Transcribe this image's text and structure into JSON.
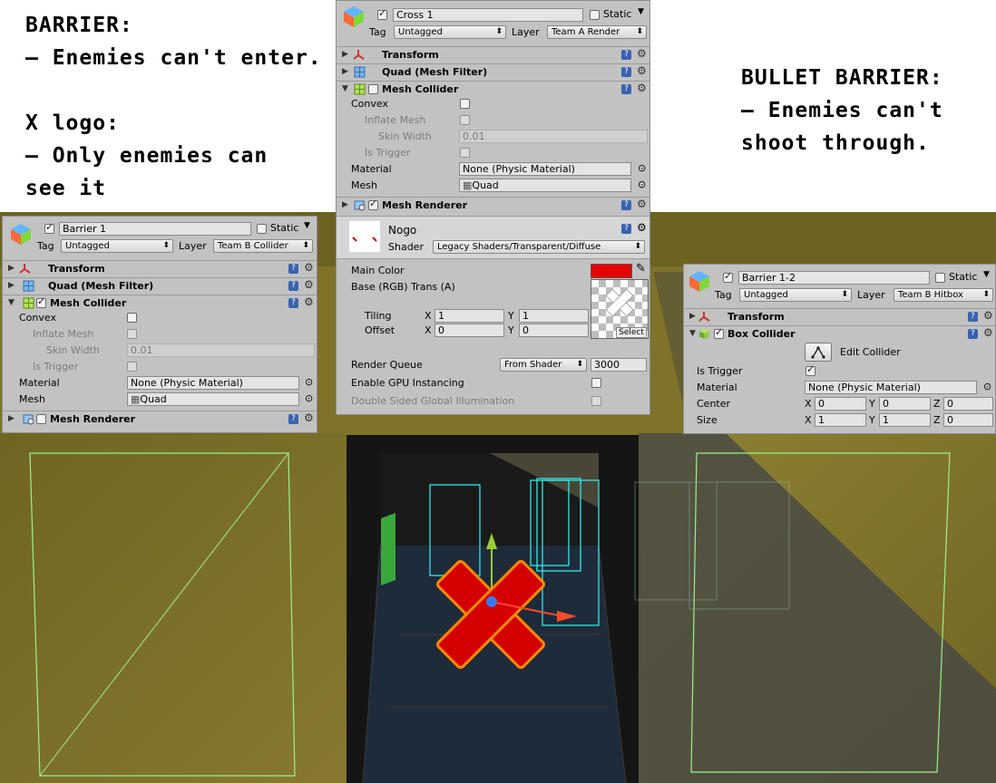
{
  "annotations": {
    "left": [
      "BARRIER:",
      "– Enemies can't enter.",
      "",
      "X logo:",
      "– Only enemies can",
      "see it"
    ],
    "right": [
      "BULLET BARRIER:",
      "– Enemies can't",
      "shoot through."
    ]
  },
  "left_inspector": {
    "object_name": "Barrier 1",
    "static_label": "Static",
    "tag_label": "Tag",
    "tag_value": "Untagged",
    "layer_label": "Layer",
    "layer_value": "Team B Collider",
    "components": {
      "transform": "Transform",
      "mesh_filter": "Quad (Mesh Filter)",
      "mesh_collider": "Mesh Collider",
      "mesh_renderer": "Mesh Renderer"
    },
    "convex_label": "Convex",
    "inflate_mesh_label": "Inflate Mesh",
    "skin_width_label": "Skin Width",
    "skin_width_value": "0.01",
    "is_trigger_label": "Is Trigger",
    "material_label": "Material",
    "material_value": "None (Physic Material)",
    "mesh_label": "Mesh",
    "mesh_value": "Quad"
  },
  "center_inspector": {
    "object_name": "Cross 1",
    "static_label": "Static",
    "tag_label": "Tag",
    "tag_value": "Untagged",
    "layer_label": "Layer",
    "layer_value": "Team A Render",
    "components": {
      "transform": "Transform",
      "mesh_filter": "Quad (Mesh Filter)",
      "mesh_collider": "Mesh Collider",
      "mesh_renderer": "Mesh Renderer"
    },
    "convex_label": "Convex",
    "inflate_mesh_label": "Inflate Mesh",
    "skin_width_label": "Skin Width",
    "skin_width_value": "0.01",
    "is_trigger_label": "Is Trigger",
    "material_label": "Material",
    "material_value": "None (Physic Material)",
    "mesh_label": "Mesh",
    "mesh_value": "Quad",
    "material_name": "Nogo",
    "shader_label": "Shader",
    "shader_value": "Legacy Shaders/Transparent/Diffuse",
    "main_color_label": "Main Color",
    "main_color": "#e60000",
    "base_label": "Base (RGB) Trans (A)",
    "tiling_label": "Tiling",
    "offset_label": "Offset",
    "tiling_x": "1",
    "tiling_y": "1",
    "offset_x": "0",
    "offset_y": "0",
    "select_label": "Select",
    "render_queue_label": "Render Queue",
    "render_queue_mode": "From Shader",
    "render_queue_value": "3000",
    "gpu_instancing_label": "Enable GPU Instancing",
    "double_sided_label": "Double Sided Global Illumination",
    "x": "X",
    "y": "Y"
  },
  "right_inspector": {
    "object_name": "Barrier 1-2",
    "static_label": "Static",
    "tag_label": "Tag",
    "tag_value": "Untagged",
    "layer_label": "Layer",
    "layer_value": "Team B Hitbox",
    "components": {
      "transform": "Transform",
      "box_collider": "Box Collider"
    },
    "edit_collider_label": "Edit Collider",
    "is_trigger_label": "Is Trigger",
    "material_label": "Material",
    "material_value": "None (Physic Material)",
    "center_label": "Center",
    "size_label": "Size",
    "center_x": "0",
    "center_y": "0",
    "center_z": "0",
    "size_x": "1",
    "size_y": "1",
    "size_z": "0",
    "x": "X",
    "y": "Y",
    "z": "Z"
  },
  "colors": {
    "inspector_bg": "#c2c2c2",
    "wall": "#7d7228",
    "gizmo_green": "#9df08a",
    "collider_cyan": "#30e8e8",
    "cross_red": "#d80000",
    "cross_outline": "#ff8a00"
  },
  "icons": [
    "gameobject-cube-icon",
    "transform-icon",
    "mesh-filter-icon",
    "mesh-collider-icon",
    "mesh-renderer-icon",
    "box-collider-icon",
    "help-icon",
    "gear-icon",
    "eyedropper-icon",
    "edit-collider-icon"
  ]
}
